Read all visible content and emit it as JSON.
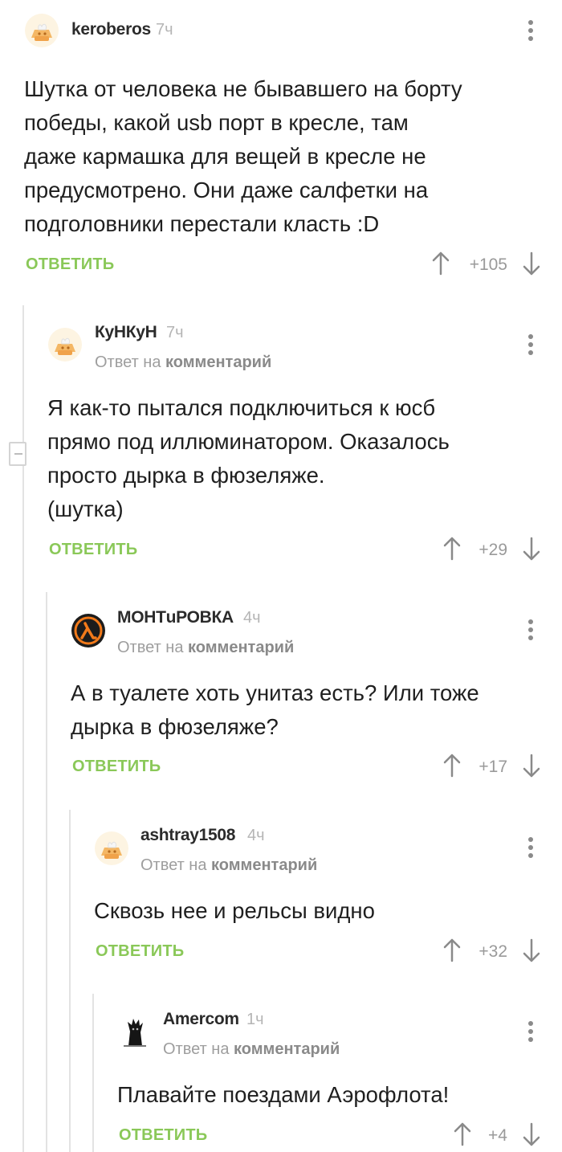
{
  "comments": [
    {
      "nick": "keroberos",
      "time": "7ч",
      "reply_prefix": "",
      "reply_link": "",
      "text": "Шутка от человека не бывавшего на борту\nпобеды, какой usb порт в кресле, там\nдаже кармашка для вещей в кресле не\nпредусмотрено. Они даже салфетки на\nподголовники перестали класть :D",
      "reply_label": "ОТВЕТИТЬ",
      "rating": "+105"
    },
    {
      "nick": "КуНКуН",
      "time": "7ч",
      "reply_prefix": "Ответ на",
      "reply_link": "комментарий",
      "text": "Я как-то пытался подключиться к юсб\nпрямо под иллюминатором. Оказалось\nпросто дырка в фюзеляже.\n(шутка)",
      "reply_label": "ОТВЕТИТЬ",
      "rating": "+29"
    },
    {
      "nick": "МОНТuРОВКА",
      "time": "4ч",
      "reply_prefix": "Ответ на",
      "reply_link": "комментарий",
      "text": "А в туалете хоть унитаз есть? Или тоже\nдырка в фюзеляже?",
      "reply_label": "ОТВЕТИТЬ",
      "rating": "+17"
    },
    {
      "nick": "ashtray1508",
      "time": "4ч",
      "reply_prefix": "Ответ на",
      "reply_link": "комментарий",
      "text": "Сквозь нее и рельсы видно",
      "reply_label": "ОТВЕТИТЬ",
      "rating": "+32"
    },
    {
      "nick": "Amercom",
      "time": "1ч",
      "reply_prefix": "Ответ на",
      "reply_link": "комментарий",
      "text": "Плавайте поездами Аэрофлота!",
      "reply_label": "ОТВЕТИТЬ",
      "rating": "+4"
    }
  ],
  "icons": {
    "avatar_default": "default-avatar-icon",
    "avatar_halflife": "lambda-logo-avatar",
    "avatar_amercom": "dark-figure-avatar",
    "upvote": "arrow-up-icon",
    "downvote": "arrow-down-icon",
    "menu": "more-vertical-icon",
    "collapse": "minus-collapse-icon"
  },
  "colors": {
    "reply_green": "#8ac858",
    "thread_line": "#e3e3e3",
    "halflife_orange": "#f27a1a"
  }
}
